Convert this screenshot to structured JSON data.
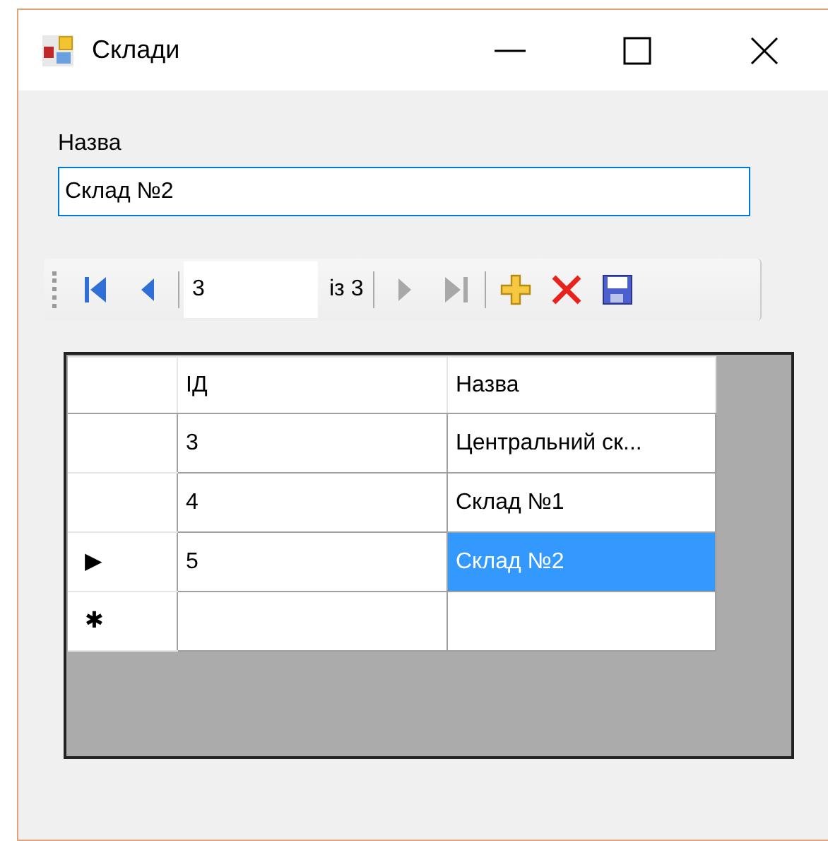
{
  "window": {
    "title": "Склади"
  },
  "name_label": "Назва",
  "name_field": {
    "value": "Склад №2"
  },
  "navigator": [
    {
      "kind": "first",
      "disabled": false
    },
    {
      "kind": "prev",
      "disabled": false
    },
    {
      "kind": "separator"
    },
    {
      "kind": "position",
      "value": "3"
    },
    {
      "kind": "count",
      "text": "із 3"
    },
    {
      "kind": "separator"
    },
    {
      "kind": "next",
      "disabled": true
    },
    {
      "kind": "last",
      "disabled": true
    },
    {
      "kind": "separator"
    },
    {
      "kind": "add",
      "disabled": false
    },
    {
      "kind": "delete",
      "disabled": false
    },
    {
      "kind": "save",
      "disabled": false
    }
  ],
  "grid": {
    "columns": [
      "ІД",
      "Назва"
    ],
    "rows": [
      {
        "marker": "",
        "cells": [
          {
            "text": "3",
            "selected": false
          },
          {
            "text": "Центральний ск...",
            "selected": false
          }
        ]
      },
      {
        "marker": "",
        "cells": [
          {
            "text": "4",
            "selected": false
          },
          {
            "text": "Склад №1",
            "selected": false
          }
        ]
      },
      {
        "marker": "▶",
        "cells": [
          {
            "text": "5",
            "selected": false
          },
          {
            "text": "Склад №2",
            "selected": true
          }
        ]
      },
      {
        "marker": "✱",
        "kind": "new"
      }
    ]
  }
}
